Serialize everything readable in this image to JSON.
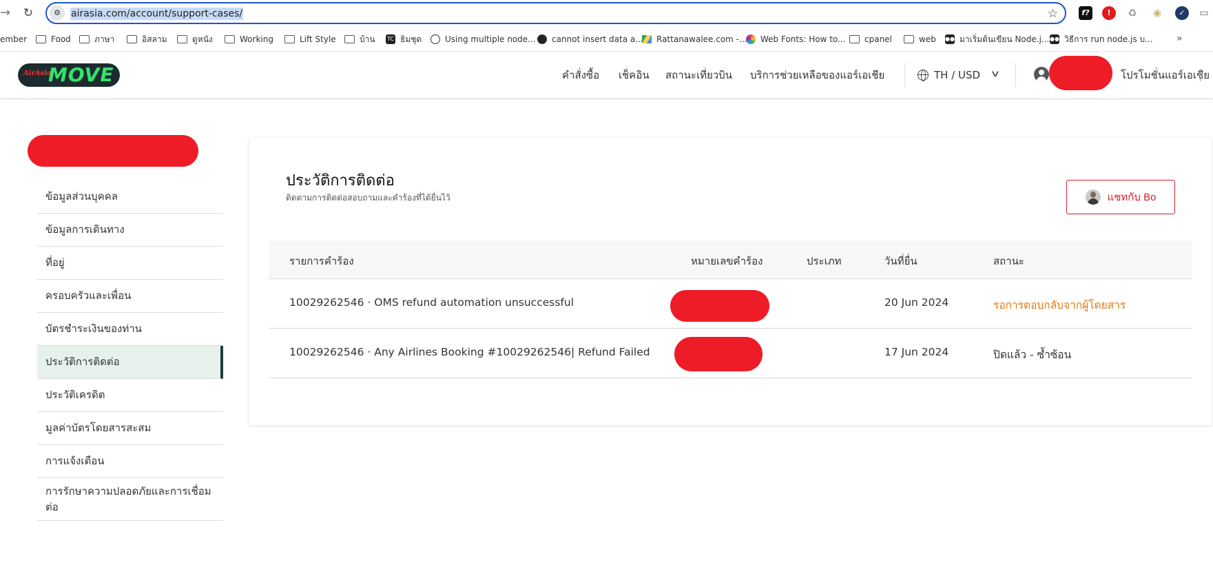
{
  "browser": {
    "url": "airasia.com/account/support-cases/",
    "bookmarks": [
      {
        "label": "ember",
        "icon": "none"
      },
      {
        "label": "Food",
        "icon": "folder-icon"
      },
      {
        "label": "ภาษา",
        "icon": "folder-icon"
      },
      {
        "label": "อิสลาม",
        "icon": "folder-icon"
      },
      {
        "label": "ดูหนัง",
        "icon": "folder-icon"
      },
      {
        "label": "Working",
        "icon": "folder-icon"
      },
      {
        "label": "Lift Style",
        "icon": "folder-icon"
      },
      {
        "label": "บ้าน",
        "icon": "folder-icon"
      },
      {
        "label": "ธิมชุด",
        "icon": "tc-icon"
      },
      {
        "label": "Using multiple node...",
        "icon": "bolt-icon"
      },
      {
        "label": "cannot insert data a...",
        "icon": "github-icon"
      },
      {
        "label": "Rattanawalee.com -...",
        "icon": "drive-icon"
      },
      {
        "label": "Web Fonts: How to...",
        "icon": "color-wheel-icon"
      },
      {
        "label": "cpanel",
        "icon": "folder-icon"
      },
      {
        "label": "web",
        "icon": "folder-icon"
      },
      {
        "label": "มาเริ่มต้นเขียน Node.j...",
        "icon": "medium-icon"
      },
      {
        "label": "วิธีการ run node.js บ...",
        "icon": "medium-icon"
      }
    ],
    "more_label": "»"
  },
  "header": {
    "nav": [
      "คำสั่งซื้อ",
      "เช็คอิน",
      "สถานะเที่ยวบิน",
      "บริการช่วยเหลือของแอร์เอเชีย"
    ],
    "locale": "TH / USD",
    "promo": "โปรโมชั่นแอร์เอเชีย",
    "logo_small": "AirAsia",
    "logo_big": "MOVE"
  },
  "sidebar": {
    "items": [
      {
        "label": "ข้อมูลส่วนบุคคล"
      },
      {
        "label": "ข้อมูลการเดินทาง"
      },
      {
        "label": "ที่อยู่"
      },
      {
        "label": "ครอบครัวและเพื่อน"
      },
      {
        "label": "บัตรชำระเงินของท่าน"
      },
      {
        "label": "ประวัติการติดต่อ"
      },
      {
        "label": "ประวัติเครดิต"
      },
      {
        "label": "มูลค่าบัตรโดยสารสะสม"
      },
      {
        "label": "การแจ้งเตือน"
      },
      {
        "label": "การรักษาความปลอดภัยและการเชื่อมต่อ"
      }
    ],
    "active_index": 5
  },
  "main": {
    "title": "ประวัติการติดต่อ",
    "subtitle": "ติดตามการติดต่อสอบถามและคำร้องที่ได้ยื่นไว้",
    "chat_button": "แชทกับ Bo",
    "table": {
      "headers": [
        "รายการคำร้อง",
        "หมายเลขคำร้อง",
        "ประเภท",
        "วันที่ยื่น",
        "สถานะ"
      ],
      "rows": [
        {
          "item": "10029262546 · OMS refund automation unsuccessful",
          "case_no": "",
          "type": "",
          "date": "20 Jun 2024",
          "status": "รอการตอบกลับจากผู้โดยสาร"
        },
        {
          "item": "10029262546 · Any Airlines Booking #10029262546| Refund Failed",
          "case_no": "",
          "type": "",
          "date": "17 Jun 2024",
          "status": "ปิดแล้ว - ซ้ำซ้อน"
        }
      ]
    }
  },
  "colors": {
    "accent_red": "#d4212c",
    "pending_orange": "#e57a12",
    "active_bg": "#e7f1eb",
    "redaction": "#ee1c26"
  }
}
